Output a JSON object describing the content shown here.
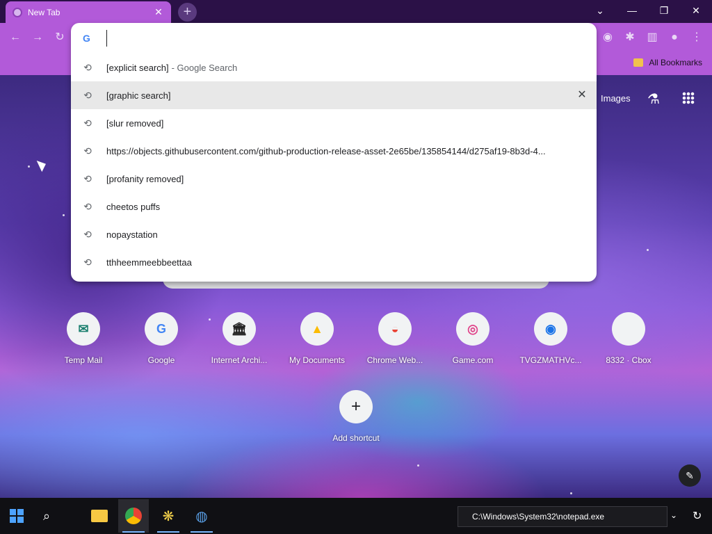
{
  "browser": {
    "tab_title": "New Tab",
    "tab_close": "✕",
    "new_tab": "+",
    "window_controls": {
      "dropdown": "⌄",
      "minimize": "—",
      "restore": "❐",
      "close": "✕"
    },
    "bookmarks": {
      "all_label": "All Bookmarks"
    }
  },
  "omnibox": {
    "value": "",
    "suggestions": [
      {
        "text": "[explicit search]",
        "suffix": "- Google Search"
      },
      {
        "text": "[graphic search]"
      },
      {
        "text": "[slur removed]"
      },
      {
        "text": "https://objects.githubusercontent.com/github-production-release-asset-2e65be/135854144/d275af19-8b3d-4..."
      },
      {
        "text": "[profanity removed]"
      },
      {
        "text": "cheetos puffs"
      },
      {
        "text": "nopaystation"
      },
      {
        "text": "tthheemmeebbeettaa"
      }
    ],
    "selected_index": 1
  },
  "page": {
    "images_label": "Images",
    "shortcuts": [
      {
        "label": "Temp Mail",
        "glyph": "✉"
      },
      {
        "label": "Google",
        "glyph": "G"
      },
      {
        "label": "Internet Archi...",
        "glyph": "🏛"
      },
      {
        "label": "My Documents",
        "glyph": "▲"
      },
      {
        "label": "Chrome Web...",
        "glyph": "◒"
      },
      {
        "label": "Game.com",
        "glyph": "◎"
      },
      {
        "label": "TVGZMATHVc...",
        "glyph": "◉"
      },
      {
        "label": "8332 · Cbox",
        "glyph": ""
      },
      {
        "label": "Add shortcut",
        "glyph": "+"
      }
    ]
  },
  "taskbar": {
    "run_value": "C:\\Windows\\System32\\notepad.exe"
  }
}
